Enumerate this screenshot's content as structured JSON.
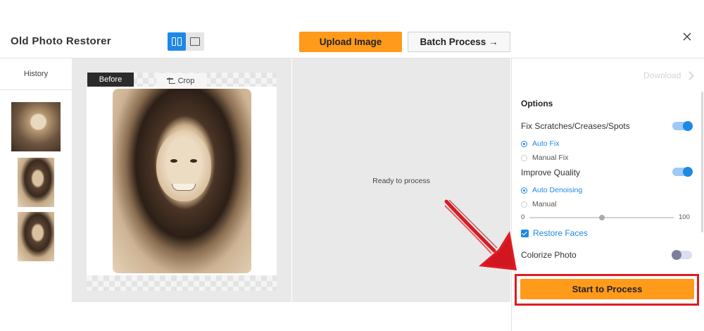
{
  "app": {
    "title": "Old Photo Restorer"
  },
  "toolbar": {
    "upload_label": "Upload Image",
    "batch_label": "Batch Process →",
    "view_modes": [
      "split-view",
      "single-view"
    ],
    "active_view": "split-view"
  },
  "history": {
    "title": "History",
    "thumbnails": [
      {
        "name": "old-photo-child"
      },
      {
        "name": "old-photo-woman"
      },
      {
        "name": "old-photo-woman"
      }
    ]
  },
  "editor": {
    "before_label": "Before",
    "crop_label": "Crop",
    "status": "Ready to process"
  },
  "sidebar": {
    "download_label": "Download",
    "options_title": "Options",
    "fix_scratches": {
      "label": "Fix Scratches/Creases/Spots",
      "enabled": true,
      "modes": [
        {
          "label": "Auto Fix",
          "selected": true
        },
        {
          "label": "Manual Fix",
          "selected": false
        }
      ]
    },
    "improve_quality": {
      "label": "Improve Quality",
      "enabled": true,
      "modes": [
        {
          "label": "Auto Denoising",
          "selected": true
        },
        {
          "label": "Manual",
          "selected": false
        }
      ],
      "slider": {
        "min": "0",
        "max": "100",
        "value": 50
      }
    },
    "restore_faces": {
      "label": "Restore Faces",
      "checked": true
    },
    "colorize": {
      "label": "Colorize Photo",
      "enabled": false
    },
    "process_label": "Start to Process"
  },
  "colors": {
    "accent": "#1e88e5",
    "primary_button": "#ff9a1a",
    "highlight": "#e01b24"
  }
}
